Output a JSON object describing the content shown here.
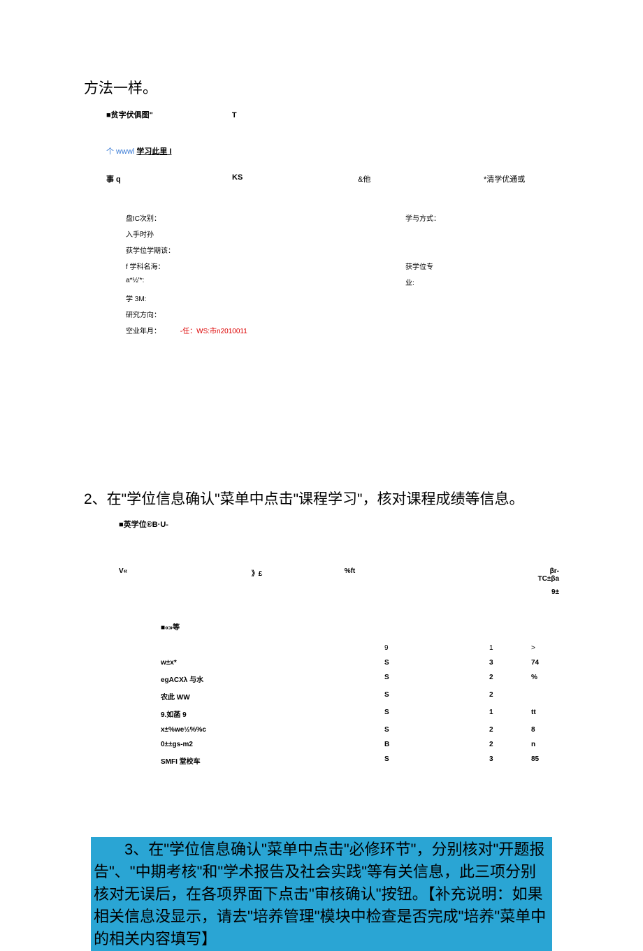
{
  "intro": {
    "text": "方法一样。"
  },
  "figure1": {
    "title": "■贫字伏俱图\"",
    "title_t": "T",
    "link_prefix": "个 wwwl ",
    "link_text": "学习此里 I",
    "tabs": {
      "q": "事 q",
      "ks": "KS",
      "others": "&他",
      "right": "*清学优通或"
    },
    "rows": [
      {
        "left": "盘IC次别：",
        "right": "学与方式："
      },
      {
        "left": "入手时孙",
        "right": ""
      },
      {
        "left": "荻学位学期该：",
        "right": ""
      },
      {
        "left": "f 学科名海：",
        "right": "获学位专"
      },
      {
        "left": "a*½'*:",
        "right": "业:"
      },
      {
        "left": "学 3M:",
        "right": ""
      },
      {
        "left": "研究方向：",
        "right": ""
      },
      {
        "left": "空业年月：",
        "right": "-任：WS:市n2010011",
        "special": true
      }
    ]
  },
  "step2": {
    "text": "2、在\"学位信息确认\"菜单中点击\"课程学习\"，核对课程成绩等信息。"
  },
  "figure2": {
    "title": "■英学位®B·U-",
    "tabs": {
      "c1": "V«",
      "c2": "》£",
      "c3": "%ft",
      "c4": "βr-TC±βa"
    },
    "right_label": "9±",
    "section": "■«»等",
    "rows": [
      {
        "name": "",
        "s": "9",
        "n": "1",
        "v": ">"
      },
      {
        "name": "w±x*",
        "s": "S",
        "n": "3",
        "v": "74"
      },
      {
        "name": "egACXλ 与水",
        "s": "S",
        "n": "2",
        "v": "%"
      },
      {
        "name": "农此 WW",
        "s": "S",
        "n": "2",
        "v": ""
      },
      {
        "name": "9.如菡 9",
        "s": "S",
        "n": "1",
        "v": "tt"
      },
      {
        "name": " x±%we½%%c",
        "s": "S",
        "n": "2",
        "v": "8"
      },
      {
        "name": "0±±gs-m2",
        "s": "B",
        "n": "2",
        "v": "n"
      },
      {
        "name": "SMFI 堂校车",
        "s": "S",
        "n": "3",
        "v": "85"
      }
    ]
  },
  "highlight": {
    "text": "3、在\"学位信息确认\"菜单中点击\"必修环节\"，分别核对\"开题报告\"、\"中期考核\"和\"学术报告及社会实践\"等有关信息，此三项分别核对无误后，在各项界面下点击\"审核确认\"按钮。【补充说明：如果相关信息没显示，请去\"培养管理\"模块中检查是否完成\"培养\"菜单中的相关内容填写】"
  }
}
